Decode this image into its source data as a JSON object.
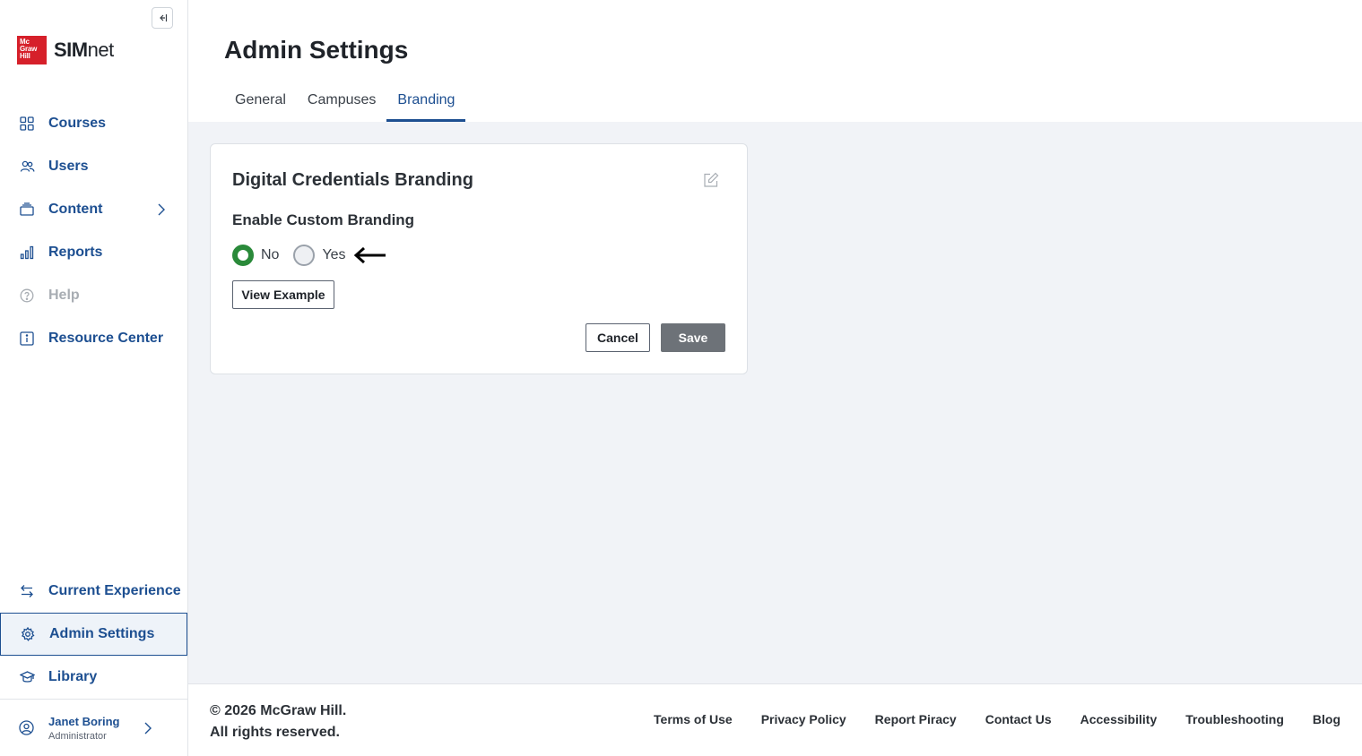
{
  "sidebar": {
    "logo": {
      "brand_line1": "Mc",
      "brand_line2": "Graw",
      "brand_line3": "Hill",
      "product_bold": "SIM",
      "product_light": "net"
    },
    "nav": [
      {
        "label": "Courses",
        "icon": "grid-icon"
      },
      {
        "label": "Users",
        "icon": "users-icon"
      },
      {
        "label": "Content",
        "icon": "content-stack-icon"
      },
      {
        "label": "Reports",
        "icon": "bar-chart-icon"
      },
      {
        "label": "Help",
        "icon": "help-circle-icon"
      },
      {
        "label": "Resource Center",
        "icon": "info-icon"
      }
    ],
    "bottom_nav": [
      {
        "label": "Current Experience",
        "icon": "swap-arrows-icon"
      },
      {
        "label": "Admin Settings",
        "icon": "gear-icon"
      },
      {
        "label": "Library",
        "icon": "graduation-cap-icon"
      }
    ],
    "user": {
      "name": "Janet Boring",
      "role": "Administrator"
    }
  },
  "header": {
    "title": "Admin Settings",
    "tabs": [
      {
        "label": "General"
      },
      {
        "label": "Campuses"
      },
      {
        "label": "Branding"
      }
    ],
    "active_tab": "Branding"
  },
  "card": {
    "title": "Digital Credentials Branding",
    "section_label": "Enable Custom Branding",
    "options": [
      {
        "label": "No",
        "selected": true
      },
      {
        "label": "Yes",
        "selected": false
      }
    ],
    "view_example_label": "View Example",
    "cancel_label": "Cancel",
    "save_label": "Save"
  },
  "footer": {
    "copyright_line1": "© 2026 McGraw Hill.",
    "copyright_line2": "All rights reserved.",
    "links": [
      "Terms of Use",
      "Privacy Policy",
      "Report Piracy",
      "Contact Us",
      "Accessibility",
      "Troubleshooting",
      "Blog"
    ]
  },
  "colors": {
    "accent": "#1d4f91",
    "brand_red": "#d6202a",
    "radio_selected": "#2a8a3a",
    "save_disabled": "#6d7278",
    "content_bg": "#f1f3f7"
  }
}
